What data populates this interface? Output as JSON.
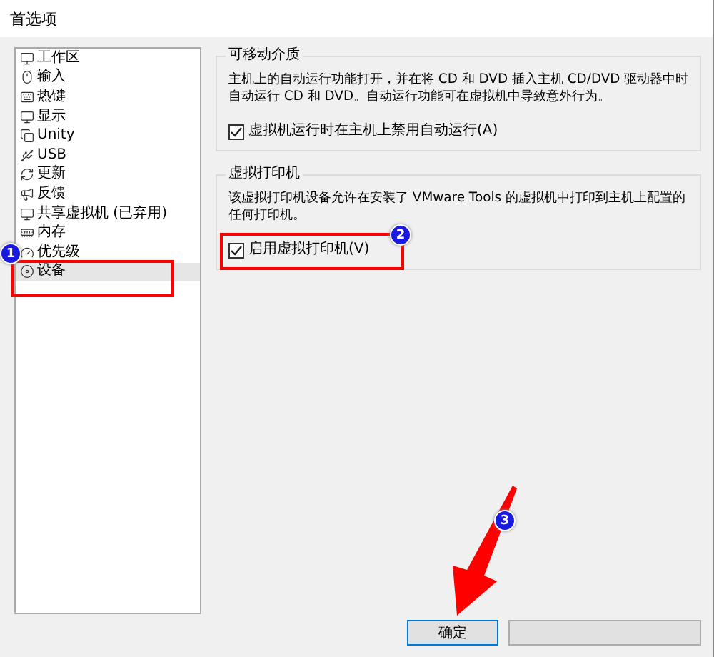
{
  "window": {
    "title": "首选项"
  },
  "sidebar": {
    "items": [
      {
        "label": "工作区",
        "selected": false
      },
      {
        "label": "输入",
        "selected": false
      },
      {
        "label": "热键",
        "selected": false
      },
      {
        "label": "显示",
        "selected": false
      },
      {
        "label": "Unity",
        "selected": false
      },
      {
        "label": "USB",
        "selected": false
      },
      {
        "label": "更新",
        "selected": false
      },
      {
        "label": "反馈",
        "selected": false
      },
      {
        "label": "共享虚拟机 (已弃用)",
        "selected": false
      },
      {
        "label": "内存",
        "selected": false
      },
      {
        "label": "优先级",
        "selected": false
      },
      {
        "label": "设备",
        "selected": true
      }
    ]
  },
  "groups": [
    {
      "title": "可移动介质",
      "description": "主机上的自动运行功能打开，并在将 CD 和 DVD 插入主机 CD/DVD 驱动器中时自动运行 CD 和 DVD。自动运行功能可在虚拟机中导致意外行为。",
      "checkbox": {
        "label": "虚拟机运行时在主机上禁用自动运行(A)",
        "checked": true
      }
    },
    {
      "title": "虚拟打印机",
      "description": "该虚拟打印机设备允许在安装了 VMware Tools 的虚拟机中打印到主机上配置的任何打印机。",
      "checkbox": {
        "label": "启用虚拟打印机(V)",
        "checked": true
      }
    }
  ],
  "buttons": [
    {
      "label": "确定",
      "focused": true
    },
    {
      "focused": false
    }
  ],
  "annotations": [
    {
      "number": "1"
    },
    {
      "number": "2"
    },
    {
      "number": "3"
    }
  ]
}
